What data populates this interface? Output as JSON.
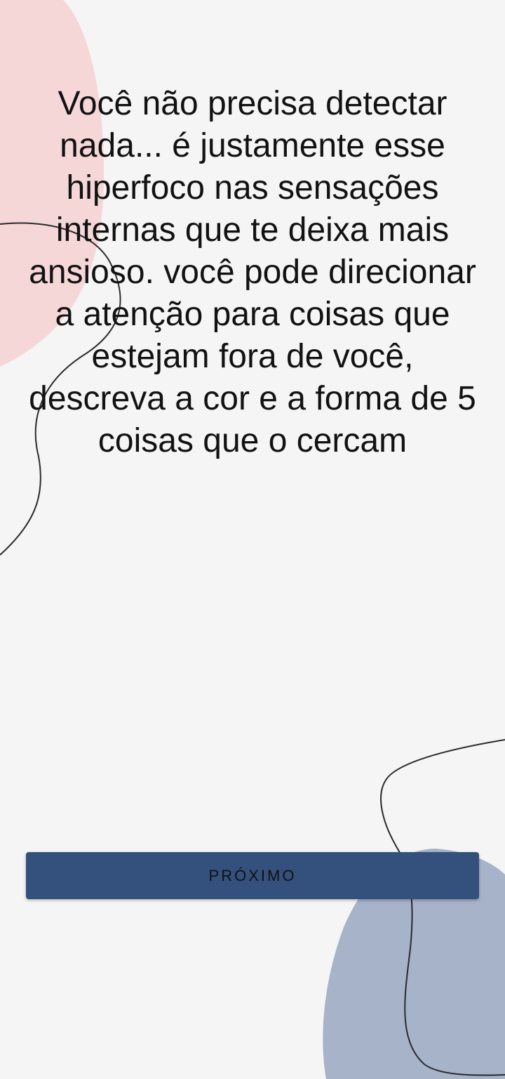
{
  "screen": {
    "message": "Você não precisa detectar nada... é justamente esse hiperfoco nas sensações internas que te deixa mais ansioso. você pode direcionar a atenção para coisas que estejam fora de você, descreva a cor e a forma de 5 coisas que o cercam",
    "next_button_label": "PRÓXIMO"
  },
  "colors": {
    "background": "#f5f5f5",
    "pink_blob": "#f6d7d8",
    "blue_blob": "#a7b3c9",
    "button": "#34507c",
    "line": "#2a2a2a"
  }
}
